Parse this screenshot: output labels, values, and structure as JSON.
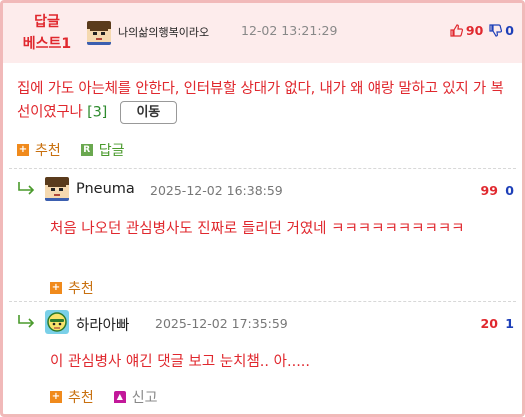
{
  "best": {
    "badge_line1": "답글",
    "badge_line2": "베스트1",
    "nickname": "나의삶의행복이라오",
    "time": "12-02 13:21:29",
    "upvotes": "90",
    "downvotes": "0",
    "text": "집에 가도 아는체를 안한다, 인터뷰할 상대가 없다, 내가 왜 얘랑 말하고 있지 가 복선이였구나",
    "reply_count": "[3]",
    "move_label": "이동",
    "recommend_label": "추천",
    "reply_label": "답글"
  },
  "replies": [
    {
      "nickname": "Pneuma",
      "time": "2025-12-02 16:38:59",
      "upvotes": "99",
      "downvotes": "0",
      "text": "처음 나오던 관심병사도 진짜로 들리던 거였네 ㅋㅋㅋㅋㅋㅋㅋㅋㅋㅋ",
      "recommend_label": "추천"
    },
    {
      "nickname": "하라아빠",
      "time": "2025-12-02 17:35:59",
      "upvotes": "20",
      "downvotes": "1",
      "text": "이 관심병사 얘긴 댓글 보고 눈치챔.. 아.....",
      "recommend_label": "추천",
      "report_label": "신고"
    }
  ],
  "colors": {
    "accent_red": "#e0282e",
    "down_blue": "#1d3fb8",
    "header_bg": "#fdecec",
    "border_pink": "#f1b9b9",
    "reply_green": "#4a9a2c",
    "recommend_orange": "#f08a1c"
  },
  "icons": {
    "upvote": "thumbs-up-icon",
    "downvote": "thumbs-down-icon",
    "recommend": "plus-icon",
    "reply": "reply-r-icon",
    "report": "siren-icon",
    "reply_arrow": "reply-arrow-icon"
  }
}
